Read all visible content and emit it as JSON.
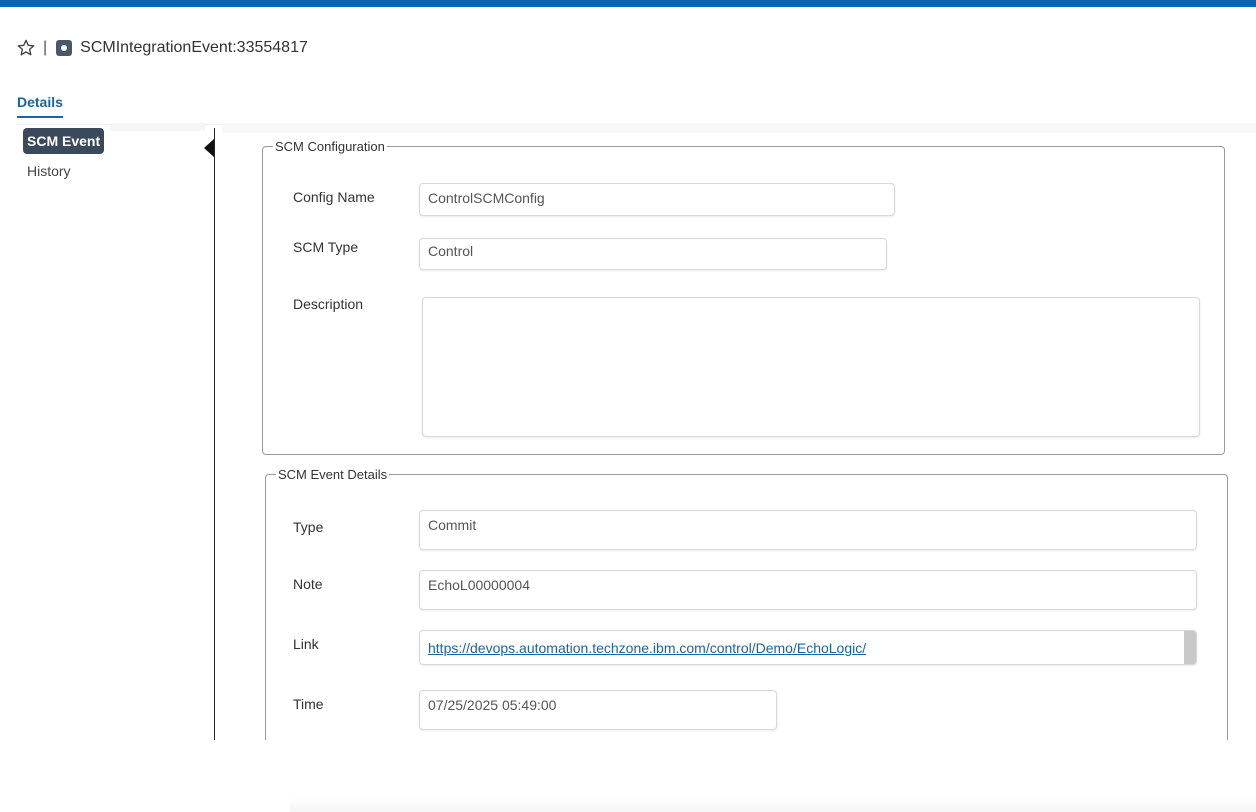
{
  "header": {
    "star_icon": "star-outline-icon",
    "separator": "|",
    "record_icon": "record-icon",
    "title": "SCMIntegrationEvent:33554817"
  },
  "tabs": [
    {
      "label": "Details",
      "active": true
    }
  ],
  "sidebar": {
    "items": [
      {
        "label": "SCM Event",
        "active": true
      },
      {
        "label": "History",
        "active": false
      }
    ]
  },
  "scm_configuration": {
    "legend": "SCM Configuration",
    "config_name": {
      "label": "Config Name",
      "value": "ControlSCMConfig"
    },
    "scm_type": {
      "label": "SCM Type",
      "value": "Control"
    },
    "description": {
      "label": "Description",
      "value": ""
    }
  },
  "scm_event_details": {
    "legend": "SCM Event Details",
    "type": {
      "label": "Type",
      "value": "Commit"
    },
    "note": {
      "label": "Note",
      "value": "EchoL00000004"
    },
    "link": {
      "label": "Link",
      "value": "https://devops.automation.techzone.ibm.com/control/Demo/EchoLogic/"
    },
    "time": {
      "label": "Time",
      "value": "07/25/2025 05:49:00"
    }
  },
  "colors": {
    "topbar": "#0f62ae",
    "accent": "#1565a8",
    "active_nav_bg": "#3a4a5c"
  }
}
